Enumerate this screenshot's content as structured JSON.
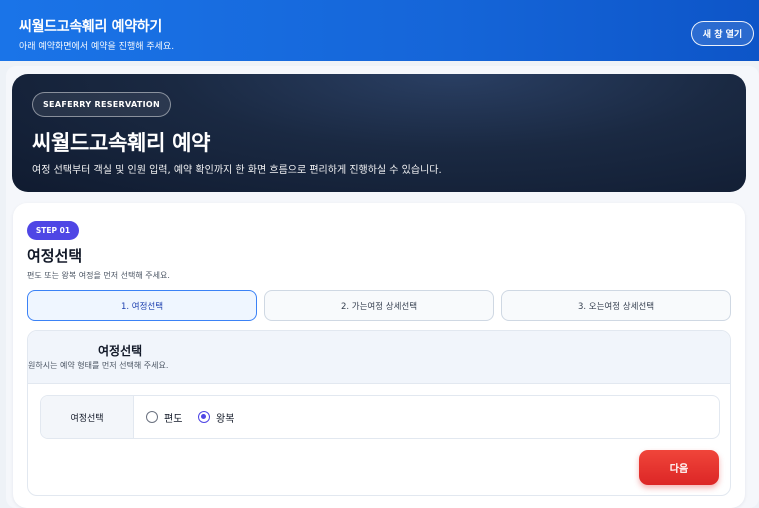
{
  "topbar": {
    "title": "씨월드고속훼리 예약하기",
    "subtitle": "아래 예약화면에서 예약을 진행해 주세요.",
    "new_window": "새 창 열기"
  },
  "hero": {
    "pill": "SEAFERRY RESERVATION",
    "title": "씨월드고속훼리 예약",
    "desc": "여정 선택부터 객실 및 인원 입력, 예약 확인까지 한 화면 흐름으로 편리하게 진행하실 수 있습니다."
  },
  "step": {
    "badge": "STEP 01",
    "title": "여정선택",
    "subtitle": "편도 또는 왕복 여정을 먼저 선택해 주세요."
  },
  "tabs": [
    {
      "label": "1. 여정선택",
      "active": true
    },
    {
      "label": "2. 가는여정 상세선택",
      "active": false
    },
    {
      "label": "3. 오는여정 상세선택",
      "active": false
    }
  ],
  "panel": {
    "title": "여정선택",
    "subtitle": "원하시는 예약 형태를 먼저 선택해 주세요.",
    "row_label": "여정선택",
    "options": [
      {
        "label": "편도",
        "checked": false
      },
      {
        "label": "왕복",
        "checked": true
      }
    ]
  },
  "next_button": "다음"
}
